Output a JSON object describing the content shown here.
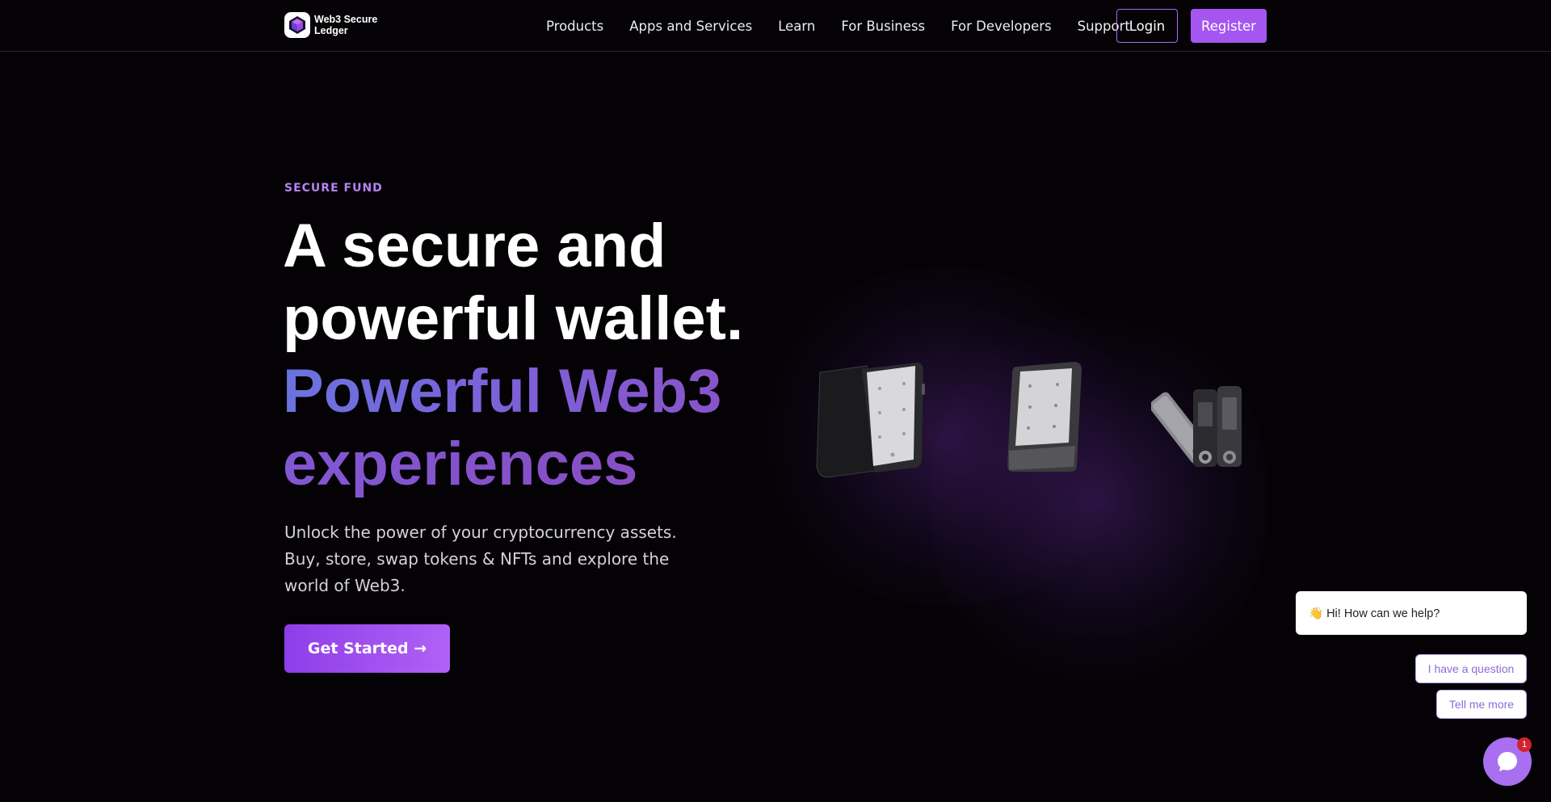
{
  "brand": {
    "name": "Web3 Secure Ledger"
  },
  "nav": {
    "items": [
      "Products",
      "Apps and Services",
      "Learn",
      "For Business",
      "For Developers",
      "Support"
    ],
    "login_label": "Login",
    "register_label": "Register"
  },
  "hero": {
    "eyebrow": "SECURE FUND",
    "headline_line1": "A secure and",
    "headline_line2": "powerful wallet.",
    "headline_line3": "Powerful Web3",
    "headline_line4": "experiences",
    "subtitle": "Unlock the power of your cryptocurrency assets. Buy, store, swap tokens & NFTs and explore the world of Web3.",
    "cta_label": "Get Started →"
  },
  "chat": {
    "greeting": "👋 Hi! How can we help?",
    "options": [
      "I have a question",
      "Tell me more"
    ],
    "badge_count": "1"
  },
  "colors": {
    "accent": "#a555f0",
    "eyebrow": "#b682f2",
    "background": "#040205"
  }
}
